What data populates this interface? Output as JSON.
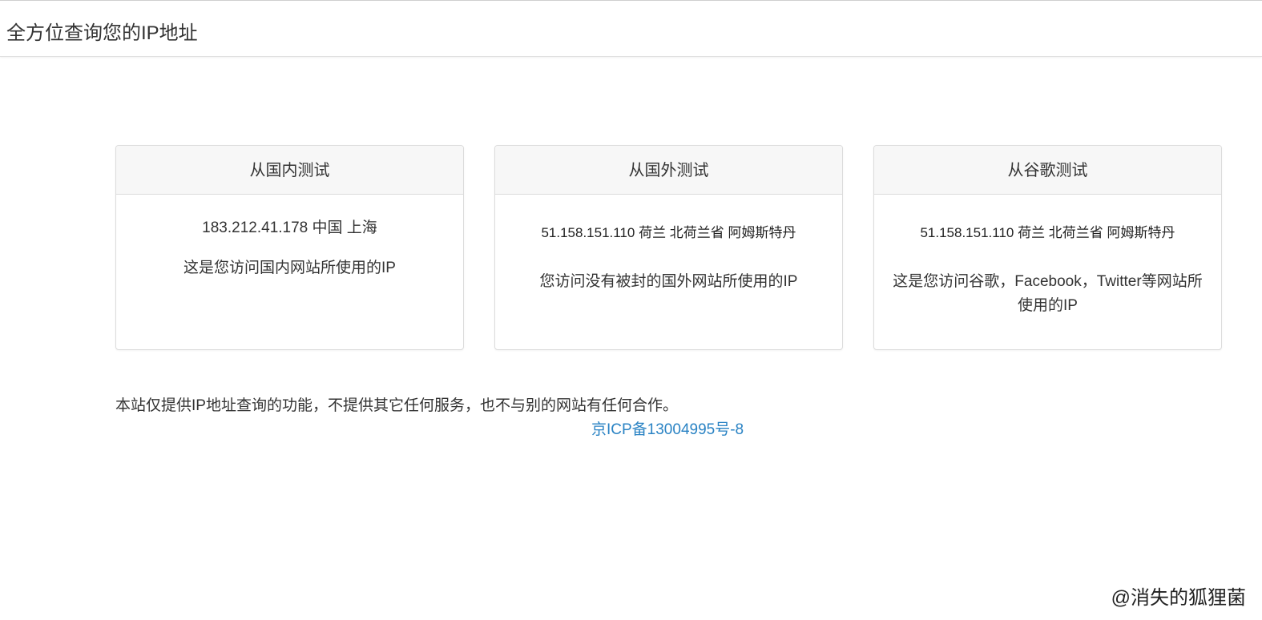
{
  "navbar": {
    "brand": "全方位查询您的IP地址"
  },
  "cards": [
    {
      "title": "从国内测试",
      "ip_info": "183.212.41.178 中国 上海",
      "description": "这是您访问国内网站所使用的IP"
    },
    {
      "title": "从国外测试",
      "ip_info": "51.158.151.110 荷兰 北荷兰省 阿姆斯特丹",
      "description": "您访问没有被封的国外网站所使用的IP"
    },
    {
      "title": "从谷歌测试",
      "ip_info": "51.158.151.110 荷兰 北荷兰省 阿姆斯特丹",
      "description": "这是您访问谷歌，Facebook，Twitter等网站所使用的IP"
    }
  ],
  "footer": {
    "notice": "本站仅提供IP地址查询的功能，不提供其它任何服务，也不与别的网站有任何合作。",
    "icp_link": "京ICP备13004995号-8"
  },
  "watermark": "@消失的狐狸菌",
  "colors": {
    "link": "#2a83c4",
    "card_header_bg": "#f7f7f7",
    "border": "#dcdcdc"
  }
}
